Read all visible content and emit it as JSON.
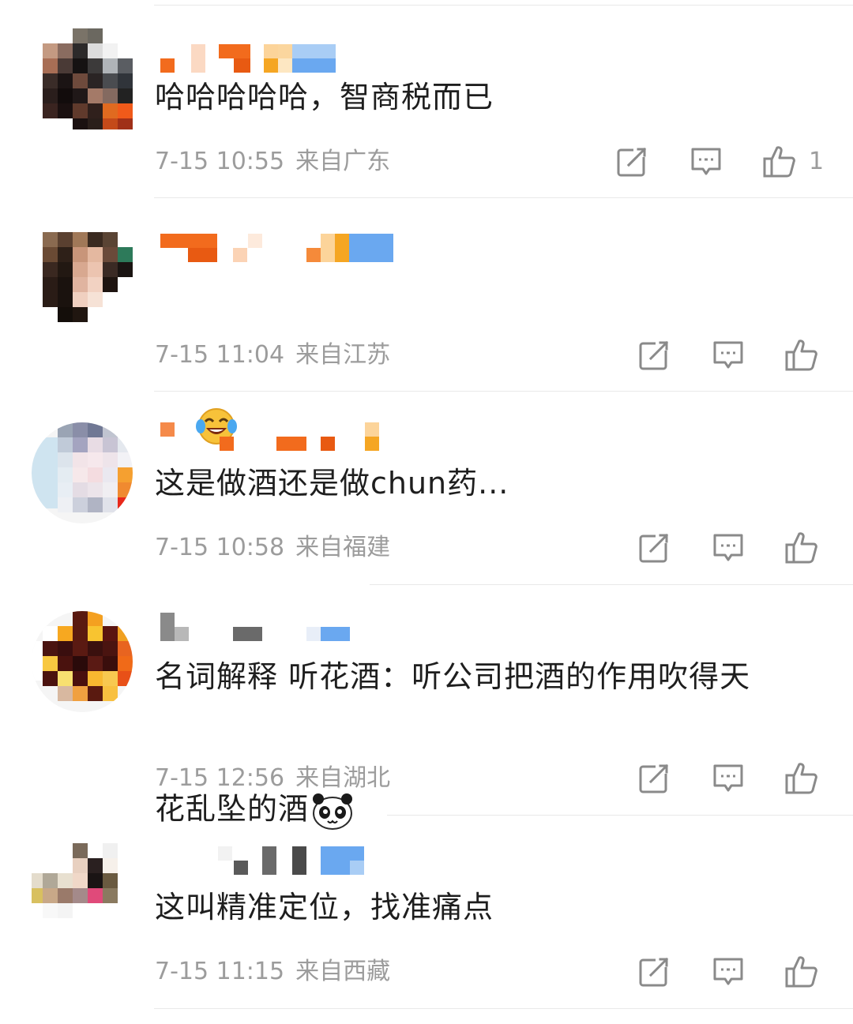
{
  "comments": [
    {
      "text": "哈哈哈哈哈，智商税而已",
      "date": "7-15 10:55",
      "location": "来自广东",
      "likes": "1",
      "emoji": null
    },
    {
      "text": "",
      "date": "7-15 11:04",
      "location": "来自江苏",
      "likes": "",
      "emoji": "laughing-crying-emoji"
    },
    {
      "text": "这是做酒还是做chun药...",
      "date": "7-15 10:58",
      "location": "来自福建",
      "likes": "",
      "emoji": null
    },
    {
      "text": "名词解释 听花酒：听公司把酒的作用吹得天\n花乱坠的酒",
      "date": "7-15 12:56",
      "location": "来自湖北",
      "likes": "",
      "emoji": "panda-emoji"
    },
    {
      "text": "这叫精准定位，找准痛点",
      "date": "7-15 11:15",
      "location": "来自西藏",
      "likes": "",
      "emoji": null
    }
  ],
  "icons": {
    "repost": "share-edit-icon",
    "comment": "comment-icon",
    "like": "thumbs-up-icon"
  },
  "colors": {
    "text": "#1e1e1e",
    "meta": "#9c9c9c",
    "icon": "#8a8a8a",
    "divider": "#e9e9e9",
    "username_orange": "#f26b1d",
    "username_blue": "#6aa8f0"
  }
}
